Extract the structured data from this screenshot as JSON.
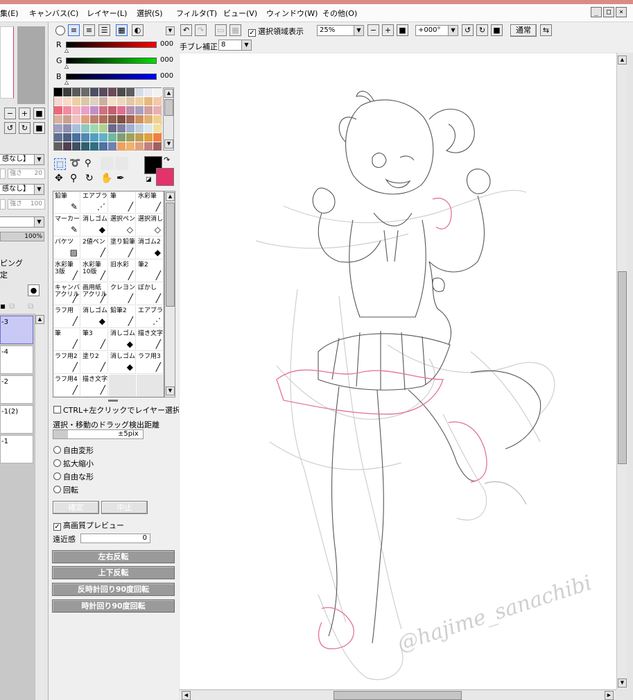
{
  "menu": {
    "items": [
      "集(E)",
      "キャンバス(C)",
      "レイヤー(L)",
      "選択(S)",
      "フィルタ(T)",
      "ビュー(V)",
      "ウィンドウ(W)",
      "その他(O)"
    ]
  },
  "window_controls": {
    "minimize": "_",
    "restore": "□",
    "close": "×"
  },
  "toolbar": {
    "selection_display_label": "選択領域表示",
    "zoom_value": "25%",
    "rotation_value": "+000°",
    "blend_mode": "通常",
    "stabilizer_label": "手ブレ補正",
    "stabilizer_value": "8"
  },
  "color": {
    "r_label": "R",
    "g_label": "G",
    "b_label": "B",
    "r_value": "000",
    "g_value": "000",
    "b_value": "000",
    "primary_color": "#000000",
    "secondary_color": "#e2336a",
    "swatches": [
      "#000000",
      "#3c3c3c",
      "#5a5a5a",
      "#6a6a6a",
      "#4c4e64",
      "#594b5e",
      "#6e4a58",
      "#4c4c4c",
      "#5e5e5e",
      "#d7dce8",
      "#eaeaf4",
      "#f2f2f2",
      "#f7d6d0",
      "#f9d9c9",
      "#eccfa4",
      "#d9c8a4",
      "#e0d0c0",
      "#c8b0a0",
      "#f5e0c8",
      "#ecd8c0",
      "#e0c8a8",
      "#f0d0a0",
      "#e8b880",
      "#f4c8a8",
      "#e86a7a",
      "#f08ca0",
      "#f4b0c0",
      "#e8a0c8",
      "#c090c8",
      "#d07080",
      "#c06070",
      "#e07090",
      "#b890b0",
      "#a8a0c0",
      "#d0a0a0",
      "#e8b0b0",
      "#d8b0a0",
      "#c8a090",
      "#f0c0c0",
      "#e0a080",
      "#c08070",
      "#b07060",
      "#906050",
      "#805040",
      "#a06858",
      "#d09060",
      "#e0b070",
      "#f0d090",
      "#a0a0c0",
      "#9090b0",
      "#a8c0d8",
      "#90c8c0",
      "#a0d8b0",
      "#b0d090",
      "#6a6a8a",
      "#8080a0",
      "#a0b0d0",
      "#c0d0e0",
      "#d8e8f0",
      "#f0e0a0",
      "#607090",
      "#506080",
      "#4a70a0",
      "#5088b0",
      "#50a0c0",
      "#60b0c8",
      "#70b8a0",
      "#80a070",
      "#a0a060",
      "#c0a050",
      "#e0a040",
      "#f08040",
      "#606060",
      "#504050",
      "#405060",
      "#306070",
      "#307080",
      "#5070a0",
      "#7080b0",
      "#f0a060",
      "#f0b070",
      "#e0a080",
      "#c08080",
      "#a06060"
    ],
    "tool_icons": [
      "select-rect",
      "lasso",
      "magic-wand",
      "move",
      "zoom",
      "rotate",
      "hand",
      "eyedropper"
    ]
  },
  "brushes": [
    {
      "label": "鉛筆",
      "icon": "✎"
    },
    {
      "label": "エアブラシ",
      "icon": "⋰"
    },
    {
      "label": "筆",
      "icon": "╱"
    },
    {
      "label": "水彩筆",
      "icon": "╱"
    },
    {
      "label": "マーカー",
      "icon": "✎"
    },
    {
      "label": "消しゴム",
      "icon": "◆"
    },
    {
      "label": "選択ペン",
      "icon": "◇"
    },
    {
      "label": "選択消し",
      "icon": "◇"
    },
    {
      "label": "バケツ",
      "icon": "▨"
    },
    {
      "label": "2値ペン",
      "icon": "╱"
    },
    {
      "label": "塗り鉛筆",
      "icon": "╱"
    },
    {
      "label": "消ゴム2",
      "icon": "◆"
    },
    {
      "label": "水彩筆\n3版",
      "icon": "╱"
    },
    {
      "label": "水彩筆\n10版",
      "icon": "╱"
    },
    {
      "label": "旧水彩",
      "icon": "╱"
    },
    {
      "label": "筆2",
      "icon": "╱"
    },
    {
      "label": "キャンバス\nアクリル",
      "icon": "╱"
    },
    {
      "label": "画用紙\nアクリル",
      "icon": "╱"
    },
    {
      "label": "クレヨン",
      "icon": "╱"
    },
    {
      "label": "ぼかし",
      "icon": "╱"
    },
    {
      "label": "ラフ用",
      "icon": "╱"
    },
    {
      "label": "消しゴム",
      "icon": "◆"
    },
    {
      "label": "鉛筆2",
      "icon": "╱"
    },
    {
      "label": "エアブラシ",
      "icon": "⋰"
    },
    {
      "label": "筆",
      "icon": "╱"
    },
    {
      "label": "筆3",
      "icon": "╱"
    },
    {
      "label": "消しゴム",
      "icon": "◆"
    },
    {
      "label": "描き文字",
      "icon": "╱"
    },
    {
      "label": "ラフ用2",
      "icon": "╱"
    },
    {
      "label": "塗り2",
      "icon": "╱"
    },
    {
      "label": "消しゴム",
      "icon": "◆"
    },
    {
      "label": "ラフ用3",
      "icon": "╱"
    },
    {
      "label": "ラフ用4",
      "icon": "╱"
    },
    {
      "label": "描き文字",
      "icon": "╱"
    },
    {
      "label": "",
      "icon": ""
    },
    {
      "label": "",
      "icon": ""
    }
  ],
  "transform": {
    "ctrl_click_label": "CTRL+左クリックでレイヤー選択",
    "drag_distance_label": "選択・移動のドラッグ検出距離",
    "drag_distance_value": "±5pix",
    "options": [
      "自由変形",
      "拡大縮小",
      "自由な形",
      "回転"
    ],
    "confirm_label": "確定",
    "cancel_label": "中止",
    "hq_preview_label": "高画質プレビュー",
    "perspective_label": "遠近感",
    "perspective_value": "0",
    "flip_h_label": "左右反転",
    "flip_v_label": "上下反転",
    "rotate_ccw_label": "反時計回り90度回転",
    "rotate_cw_label": "時計回り90度回転"
  },
  "left_panel": {
    "brush_mode_1": "感なし】",
    "strength_label_1": "強さ",
    "strength_value_1": "20",
    "brush_mode_2": "感なし】",
    "strength_label_2": "強さ",
    "strength_value_2": "100",
    "opacity_value": "100%",
    "clipping_label": "ピング",
    "lock_label": "定",
    "layers": [
      "-3",
      "-4",
      "-2",
      "-1(2)",
      "-1"
    ]
  },
  "canvas": {
    "signature": "@hajime_sanachibi"
  }
}
